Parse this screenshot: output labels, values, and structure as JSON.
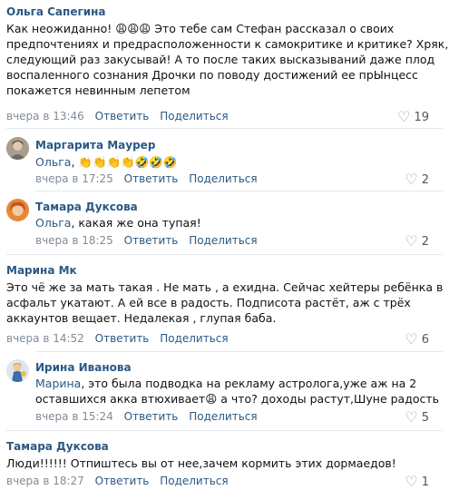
{
  "comments": [
    {
      "author": "Ольга Сапегина",
      "lines": [
        "Как неожиданно! 😩😩😩 Это тебе сам Стефан рассказал о своих",
        "предпочтениях и предрасположенности к самокритике и критике? Хряк, в",
        "следующий раз закусывай! А то после таких высказываний даже плод",
        "воспаленного сознания Дрочки по поводу достижений ее прЫнцесс",
        "покажется невинным лепетом"
      ],
      "date": "вчера в 13:46",
      "reply": "Ответить",
      "share": "Поделиться",
      "likes": "19"
    },
    {
      "author": "Маргарита Маурер",
      "mention": "Ольга",
      "after": ", 👏👏👏👏🤣🤣🤣",
      "date": "вчера в 17:25",
      "reply": "Ответить",
      "share": "Поделиться",
      "likes": "2"
    },
    {
      "author": "Тамара Дуксова",
      "mention": "Ольга",
      "after": ", какая же она тупая!",
      "date": "вчера в 18:25",
      "reply": "Ответить",
      "share": "Поделиться",
      "likes": "2"
    },
    {
      "author": "Марина Мк",
      "lines": [
        "Это чё же за мать такая . Не мать , а ехидна. Сейчас хейтеры ребёнка в",
        "асфальт укатают. А ей все в радость. Подписота растёт, аж с трёх",
        "аккаунтов вещает. Недалекая , глупая баба."
      ],
      "date": "вчера в 14:52",
      "reply": "Ответить",
      "share": "Поделиться",
      "likes": "6"
    },
    {
      "author": "Ирина Иванова",
      "mention": "Марина",
      "after": ", это была подводка на рекламу астролога,уже аж на 2",
      "line2": "оставшихся акка втюхивает😩 а что? доходы растут,Шуне радость",
      "date": "вчера в 15:24",
      "reply": "Ответить",
      "share": "Поделиться",
      "likes": "5"
    },
    {
      "author": "Тамара Дуксова",
      "lines": [
        "Люди!!!!!! Отпиштесь вы от нее,зачем кормить этих дормаедов!"
      ],
      "date": "вчера в 18:27",
      "reply": "Ответить",
      "share": "Поделиться",
      "likes": "1"
    }
  ],
  "colors": {
    "link": "#2a5885",
    "meta": "#818c99",
    "divider": "#e7e8ec"
  },
  "icons": {
    "like": "heart-icon"
  }
}
